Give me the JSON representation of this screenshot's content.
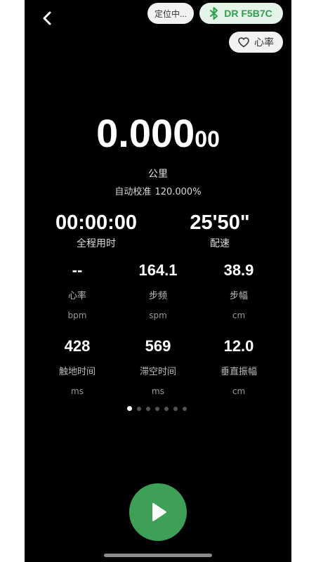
{
  "header": {
    "back_icon": "chevron-left-icon",
    "locating_label": "定位中...",
    "device_label": "DR F5B7C",
    "device_icon": "bluetooth-icon",
    "heart_label": "心率",
    "heart_icon": "heart-outline-icon",
    "colors": {
      "device_accent": "#2f9e4f",
      "device_bg": "#e4f4e8"
    }
  },
  "distance": {
    "value_main": "0.000",
    "value_small": "00",
    "unit": "公里",
    "calibration_label": "自动校准",
    "calibration_value": "120.000%"
  },
  "primary_stats": [
    {
      "value": "00:00:00",
      "label": "全程用时"
    },
    {
      "value": "25'50\"",
      "label": "配速"
    }
  ],
  "stats": [
    {
      "value": "--",
      "label": "心率",
      "unit": "bpm"
    },
    {
      "value": "164.1",
      "label": "步频",
      "unit": "spm"
    },
    {
      "value": "38.9",
      "label": "步幅",
      "unit": "cm"
    },
    {
      "value": "428",
      "label": "触地时间",
      "unit": "ms"
    },
    {
      "value": "569",
      "label": "滞空时间",
      "unit": "ms"
    },
    {
      "value": "12.0",
      "label": "垂直振幅",
      "unit": "cm"
    }
  ],
  "pager": {
    "page_count": 7,
    "current_page": 1
  },
  "controls": {
    "play_icon": "play-icon",
    "play_color": "#3e9f56"
  }
}
